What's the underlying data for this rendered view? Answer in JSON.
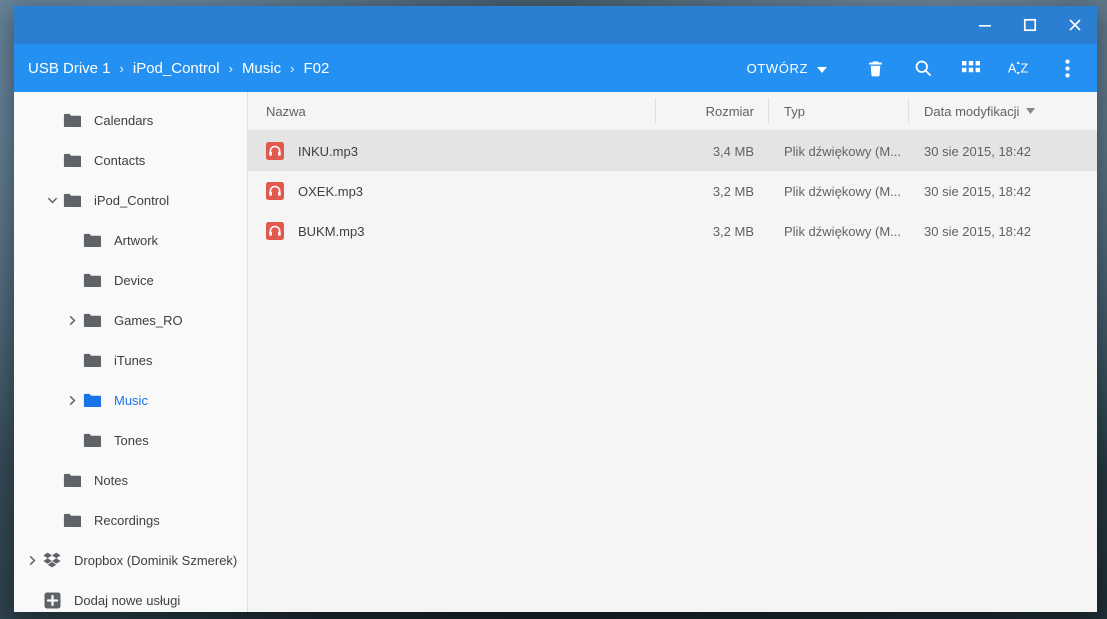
{
  "window": {
    "controls": [
      {
        "name": "minimize-button",
        "icon": "minimize-icon"
      },
      {
        "name": "maximize-button",
        "icon": "maximize-icon"
      },
      {
        "name": "close-button",
        "icon": "close-icon"
      }
    ]
  },
  "breadcrumb": {
    "separator": "›",
    "items": [
      "USB Drive 1",
      "iPod_Control",
      "Music",
      "F02"
    ]
  },
  "toolbar": {
    "open_label": "OTWÓRZ",
    "buttons": [
      {
        "name": "delete-button",
        "icon": "trash-icon"
      },
      {
        "name": "search-button",
        "icon": "search-icon"
      },
      {
        "name": "view-grid-button",
        "icon": "grid-icon"
      },
      {
        "name": "sort-button",
        "icon": "sort-az-icon"
      },
      {
        "name": "more-options-button",
        "icon": "kebab-menu-icon"
      }
    ]
  },
  "sidebar": {
    "items": [
      {
        "label": "Calendars",
        "indent": 1,
        "twisty": "none",
        "icon": "folder-icon",
        "selected": false
      },
      {
        "label": "Contacts",
        "indent": 1,
        "twisty": "none",
        "icon": "folder-icon",
        "selected": false
      },
      {
        "label": "iPod_Control",
        "indent": 1,
        "twisty": "expanded",
        "icon": "folder-icon",
        "selected": false
      },
      {
        "label": "Artwork",
        "indent": 2,
        "twisty": "none",
        "icon": "folder-icon",
        "selected": false
      },
      {
        "label": "Device",
        "indent": 2,
        "twisty": "none",
        "icon": "folder-icon",
        "selected": false
      },
      {
        "label": "Games_RO",
        "indent": 2,
        "twisty": "collapsed",
        "icon": "folder-icon",
        "selected": false
      },
      {
        "label": "iTunes",
        "indent": 2,
        "twisty": "none",
        "icon": "folder-icon",
        "selected": false
      },
      {
        "label": "Music",
        "indent": 2,
        "twisty": "collapsed",
        "icon": "folder-icon-blue",
        "selected": true
      },
      {
        "label": "Tones",
        "indent": 2,
        "twisty": "none",
        "icon": "folder-icon",
        "selected": false
      },
      {
        "label": "Notes",
        "indent": 1,
        "twisty": "none",
        "icon": "folder-icon",
        "selected": false
      },
      {
        "label": "Recordings",
        "indent": 1,
        "twisty": "none",
        "icon": "folder-icon",
        "selected": false
      },
      {
        "label": "Dropbox (Dominik Szmerek)",
        "indent": 0,
        "twisty": "collapsed",
        "icon": "dropbox-icon",
        "selected": false
      },
      {
        "label": "Dodaj nowe usługi",
        "indent": 0,
        "twisty": "none",
        "icon": "add-service-icon",
        "selected": false
      }
    ]
  },
  "filelist": {
    "columns": [
      {
        "label": "Nazwa",
        "sorted": false
      },
      {
        "label": "Rozmiar",
        "sorted": false
      },
      {
        "label": "Typ",
        "sorted": false
      },
      {
        "label": "Data modyfikacji",
        "sorted": true
      }
    ],
    "rows": [
      {
        "name": "INKU.mp3",
        "size": "3,4 MB",
        "type": "Plik dźwiękowy (M...",
        "date": "30 sie 2015, 18:42",
        "icon": "audio-file-icon",
        "selected": true
      },
      {
        "name": "OXEK.mp3",
        "size": "3,2 MB",
        "type": "Plik dźwiękowy (M...",
        "date": "30 sie 2015, 18:42",
        "icon": "audio-file-icon",
        "selected": false
      },
      {
        "name": "BUKM.mp3",
        "size": "3,2 MB",
        "type": "Plik dźwiękowy (M...",
        "date": "30 sie 2015, 18:42",
        "icon": "audio-file-icon",
        "selected": false
      }
    ]
  },
  "colors": {
    "titlebar": "#2a7fd3",
    "toolbar": "#2491f2",
    "accent": "#1a73e8",
    "audio_icon": "#e05a4e",
    "row_selected": "#e4e4e4"
  }
}
